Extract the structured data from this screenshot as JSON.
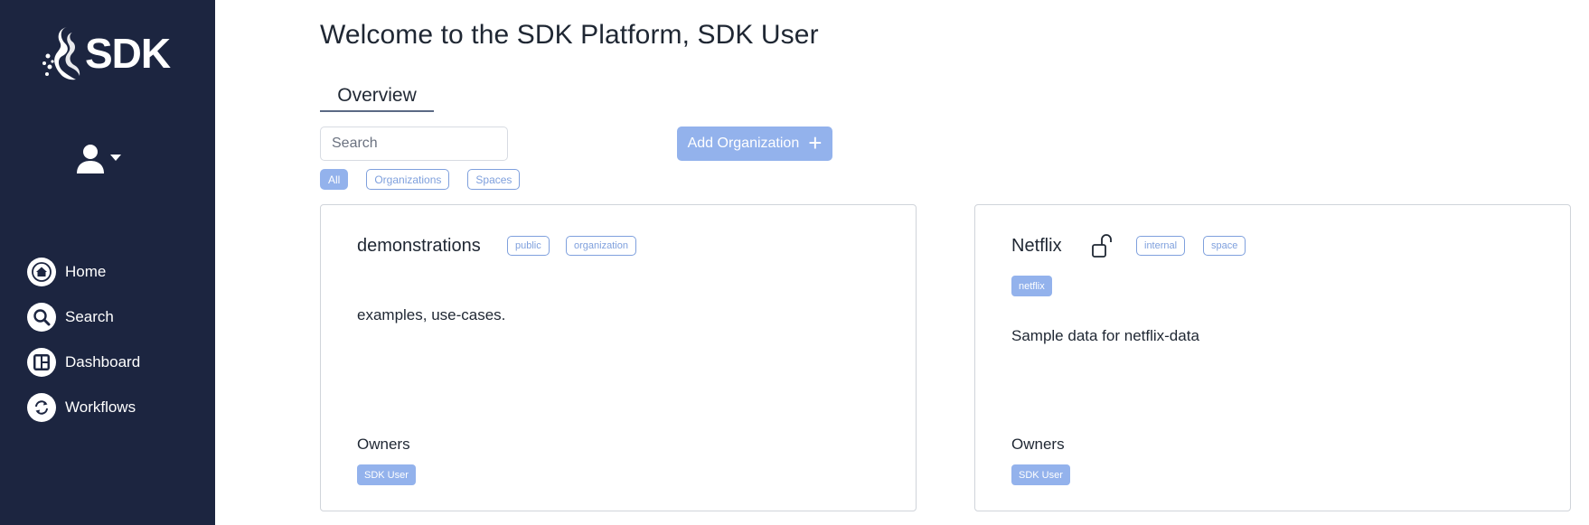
{
  "sidebar": {
    "logo_text": "SDK",
    "items": [
      {
        "label": "Home",
        "icon": "home-icon"
      },
      {
        "label": "Search",
        "icon": "search-icon"
      },
      {
        "label": "Dashboard",
        "icon": "dashboard-icon"
      },
      {
        "label": "Workflows",
        "icon": "workflows-icon"
      }
    ]
  },
  "header": {
    "title": "Welcome to the SDK Platform, SDK User"
  },
  "tabs": {
    "overview": "Overview"
  },
  "search": {
    "placeholder": "Search"
  },
  "toolbar": {
    "add_organization_label": "Add Organization",
    "add_icon": "+"
  },
  "filters": {
    "all": "All",
    "organizations": "Organizations",
    "spaces": "Spaces",
    "active": "All"
  },
  "cards": [
    {
      "title": "demonstrations",
      "tags": [
        "public",
        "organization"
      ],
      "labels": [],
      "description": "examples, use-cases.",
      "owners_label": "Owners",
      "owners": [
        "SDK User"
      ]
    },
    {
      "title": "Netflix",
      "tags": [
        "internal",
        "space"
      ],
      "labels": [
        "netflix"
      ],
      "icon": "unlock-icon",
      "description": "Sample data for netflix-data",
      "owners_label": "Owners",
      "owners": [
        "SDK User"
      ]
    }
  ],
  "colors": {
    "sidebar_bg": "#1c2540",
    "accent": "#93b2ec",
    "accent_border": "#7fa0dd"
  }
}
